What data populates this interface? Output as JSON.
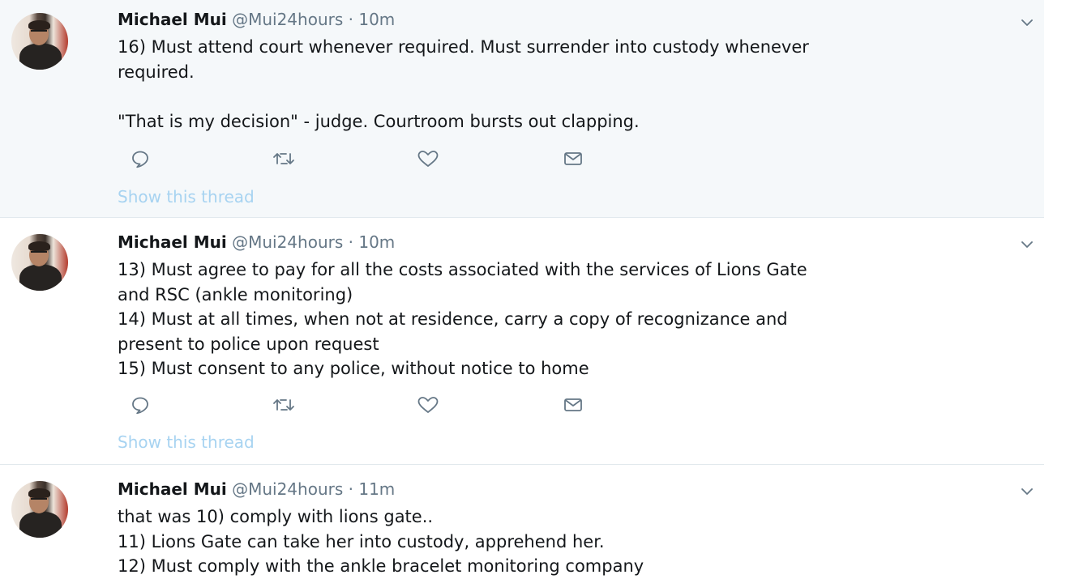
{
  "tweets": [
    {
      "name": "Michael Mui",
      "handle": "@Mui24hours",
      "separator": "·",
      "time": "10m",
      "lines": [
        "16) Must attend court whenever required. Must surrender into custody whenever",
        "required.",
        "",
        "\"That is my decision\" - judge. Courtroom bursts out clapping."
      ],
      "show_thread": "Show this thread"
    },
    {
      "name": "Michael Mui",
      "handle": "@Mui24hours",
      "separator": "·",
      "time": "10m",
      "lines": [
        "13) Must agree to pay for all the costs associated with the services of Lions Gate",
        "and RSC (ankle monitoring)",
        "14) Must at all times, when not at residence, carry a copy of recognizance and",
        "present to police upon request",
        "15) Must consent to any police, without notice to home"
      ],
      "show_thread": "Show this thread"
    },
    {
      "name": "Michael Mui",
      "handle": "@Mui24hours",
      "separator": "·",
      "time": "11m",
      "lines": [
        "that was 10) comply with lions gate..",
        "11) Lions Gate can take her into custody, apprehend her.",
        "12) Must comply with the ankle bracelet monitoring company"
      ]
    }
  ],
  "icons": {
    "reply": "reply-icon",
    "retweet": "retweet-icon",
    "like": "heart-icon",
    "message": "envelope-icon",
    "menu": "chevron-down-icon"
  },
  "colors": {
    "name": "#14171a",
    "meta": "#657786",
    "icon": "#657786",
    "show_thread": "#a7d3f1",
    "highlight_bg": "#f5f8fa"
  }
}
